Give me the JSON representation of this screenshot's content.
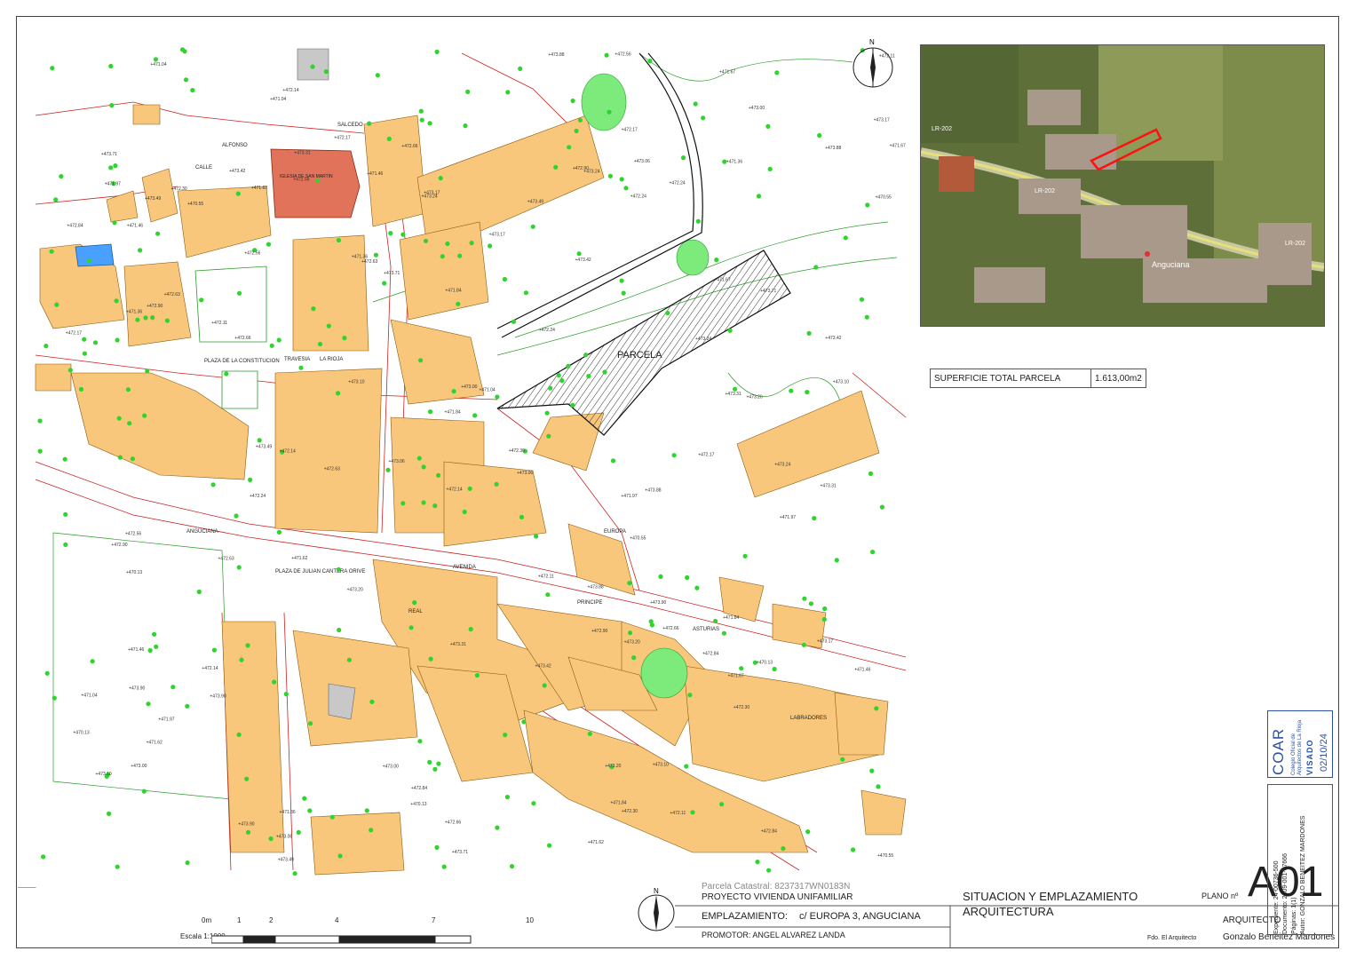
{
  "map": {
    "parcela_label": "PARCELA",
    "north_label": "N",
    "streets": [
      {
        "text": "CALLE",
        "sub": ""
      },
      {
        "text": "ALFONSO",
        "sub": ""
      },
      {
        "text": "SALCEDO",
        "sub": ""
      },
      {
        "text": "TRAVESIA",
        "sub": ""
      },
      {
        "text": "LA RIOJA",
        "sub": ""
      },
      {
        "text": "PLAZA DE LA CONSTITUCION",
        "sub": ""
      },
      {
        "text": "ANGUCIANA",
        "sub": ""
      },
      {
        "text": "PLAZA DE JULIAN CANTERA ORIVE",
        "sub": ""
      },
      {
        "text": "AVENIDA",
        "sub": ""
      },
      {
        "text": "EUROPA",
        "sub": ""
      },
      {
        "text": "PRINCIPE",
        "sub": ""
      },
      {
        "text": "ASTURIAS",
        "sub": ""
      },
      {
        "text": "REAL",
        "sub": ""
      },
      {
        "text": "LABRADORES",
        "sub": ""
      },
      {
        "text": "IGLESIA DE SAN MARTIN",
        "sub": ""
      }
    ],
    "elevations": [
      "470.13",
      "470.55",
      "471.04",
      "471.67",
      "471.84",
      "471.46",
      "471.36",
      "471.62",
      "472.30",
      "472.14",
      "472.17",
      "472.24",
      "471.97",
      "472.56",
      "472.63",
      "472.90",
      "472.84",
      "473.06",
      "473.24",
      "473.31",
      "473.49",
      "473.71",
      "473.88",
      "473.90",
      "473.10",
      "473.20",
      "473.42",
      "473.17",
      "473.00",
      "472.66",
      "472.11"
    ]
  },
  "aerial": {
    "road_labels": [
      "LR-202",
      "LR-202",
      "LR-202"
    ],
    "place_label": "Anguciana"
  },
  "area_table": {
    "label": "SUPERFICIE TOTAL PARCELA",
    "value": "1.613,00m2"
  },
  "scale_bar": {
    "title": "Escala 1:1000",
    "ticks": [
      "0m",
      "1",
      "2",
      "4",
      "7",
      "10"
    ]
  },
  "title_block": {
    "catastral": "Parcela Catastral: 8237317WN0183N",
    "project": "PROYECTO VIVIENDA UNIFAMILIAR",
    "emplazamiento_label": "EMPLAZAMIENTO:",
    "emplazamiento_value": "c/ EUROPA 3, ANGUCIANA",
    "promotor": "PROMOTOR: ANGEL ALVAREZ LANDA",
    "plan_title_1": "SITUACION Y EMPLAZAMIENTO",
    "plan_title_2": "ARQUITECTURA",
    "plano_label": "PLANO nº",
    "plano_number": "A01",
    "architect_label": "ARQUITECTO",
    "fdo_label": "Fdo. El Arquitecto",
    "architect_name": "Gonzalo Beneitez Mardones"
  },
  "stamp": {
    "logo": "COAR",
    "org_line1": "Colegio Oficial de",
    "org_line2": "Arquitectos de La Rioja",
    "visado": "VISADO",
    "date": "02/10/24"
  },
  "registry": {
    "expediente": "Expediente: 24-00736-500",
    "documento": "Documento: 2409-001-07666",
    "paginas": "Páginas: 1(1)",
    "autor": "Autor: GONZALO BENEITEZ MARDONES"
  },
  "colors": {
    "building": "#F9C77C",
    "church": "#E0735A",
    "parcel_line": "#d32020",
    "green_point": "#2fd42f",
    "park": "#7CEB7C"
  }
}
